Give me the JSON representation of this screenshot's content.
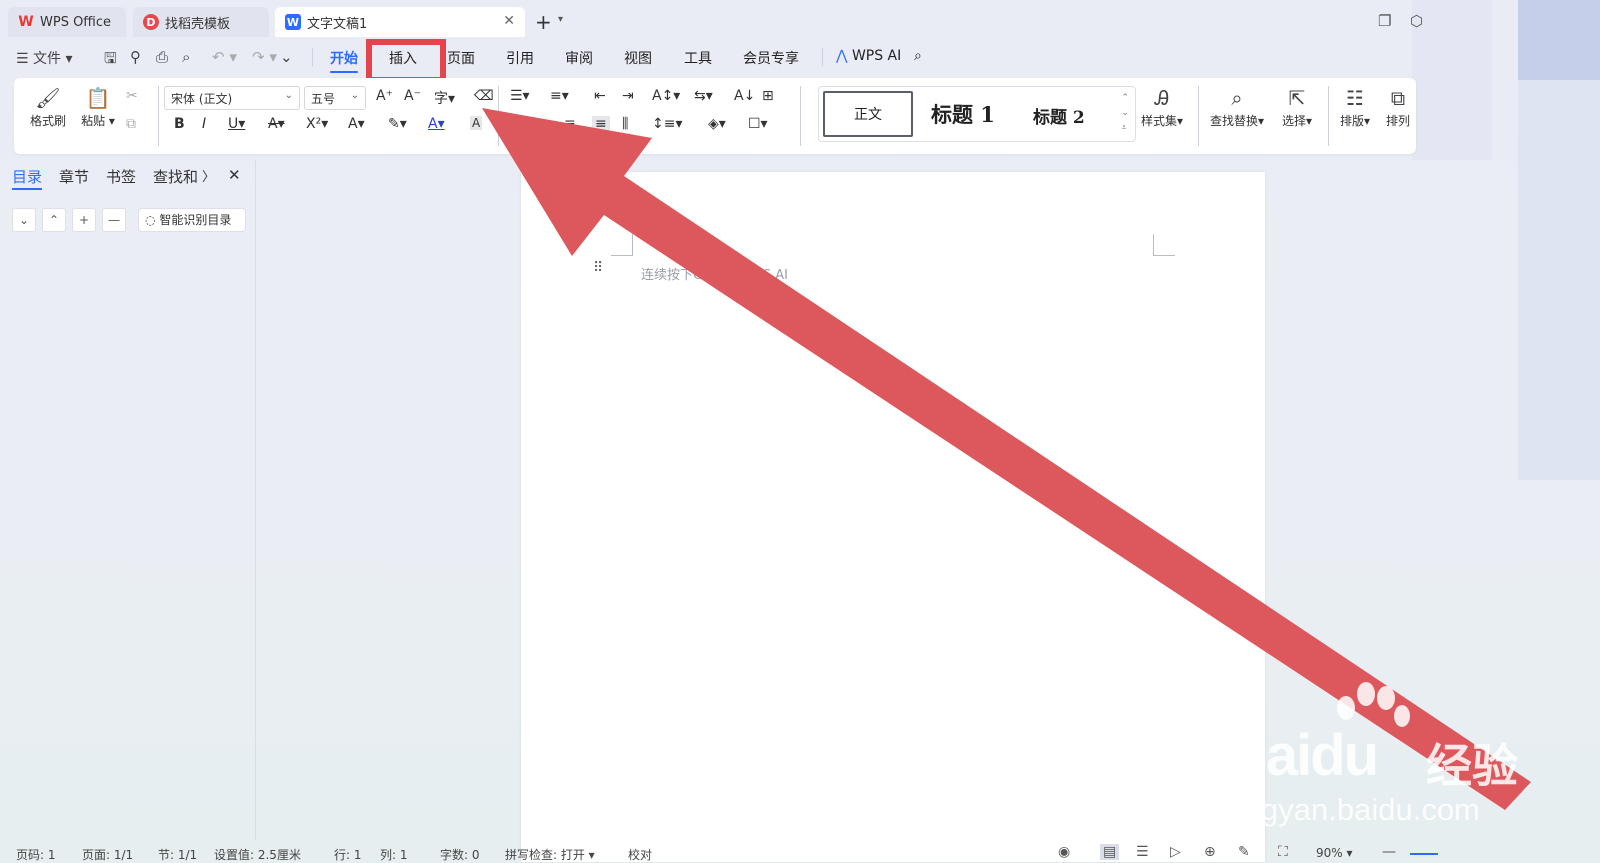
{
  "tabs": [
    {
      "label": "WPS Office"
    },
    {
      "label": "找稻壳模板"
    },
    {
      "label": "文字文稿1"
    }
  ],
  "menu": {
    "file": "文件",
    "items": [
      "开始",
      "插入",
      "页面",
      "引用",
      "审阅",
      "视图",
      "工具",
      "会员专享"
    ],
    "wps_ai": "WPS AI"
  },
  "ribbon": {
    "format_painter": "格式刷",
    "paste": "粘贴",
    "font_name": "宋体 (正文)",
    "font_size": "五号",
    "styles": {
      "normal": "正文",
      "h1": "标题 1",
      "h2": "标题 2"
    },
    "style_set": "样式集",
    "find_replace": "查找替换",
    "select": "选择",
    "layout": "排版",
    "arrange": "排列"
  },
  "nav": {
    "tabs": [
      "目录",
      "章节",
      "书签",
      "查找和"
    ],
    "ai_toc": "智能识别目录"
  },
  "document": {
    "hint": "连续按下Ctrl唤起WPS AI"
  },
  "status": {
    "page": "页码: 1",
    "pages": "页面: 1/1",
    "section": "节: 1/1",
    "setting": "设置值: 2.5厘米",
    "row": "行: 1",
    "col": "列: 1",
    "words": "字数: 0",
    "spellcheck": "拼写检查: 打开",
    "proof": "校对",
    "zoom": "90%"
  },
  "watermark": {
    "brand": "Baidu",
    "brand_cn": "经验",
    "url": "jingyan.baidu.com"
  },
  "colors": {
    "accent": "#2f6bff",
    "annotation": "#e0464c"
  }
}
